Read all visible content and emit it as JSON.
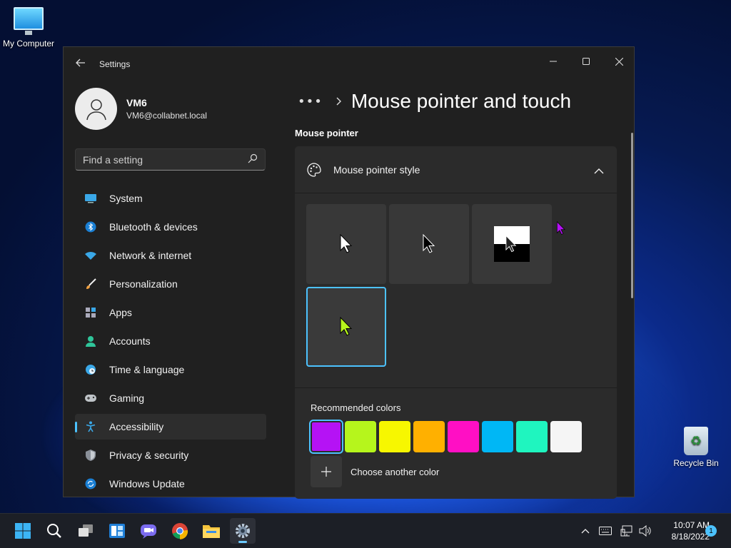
{
  "desktop": {
    "icons": [
      {
        "label": "My Computer",
        "icon": "computer-monitor-icon"
      },
      {
        "label": "Recycle Bin",
        "icon": "recycle-bin-icon"
      }
    ]
  },
  "window": {
    "app_title": "Settings",
    "controls": [
      "minimize",
      "maximize",
      "close"
    ]
  },
  "profile": {
    "name": "VM6",
    "email": "VM6@collabnet.local"
  },
  "search": {
    "placeholder": "Find a setting"
  },
  "nav": {
    "items": [
      {
        "label": "System",
        "icon": "system-icon"
      },
      {
        "label": "Bluetooth & devices",
        "icon": "bluetooth-icon"
      },
      {
        "label": "Network & internet",
        "icon": "wifi-icon"
      },
      {
        "label": "Personalization",
        "icon": "brush-icon"
      },
      {
        "label": "Apps",
        "icon": "apps-icon"
      },
      {
        "label": "Accounts",
        "icon": "accounts-icon"
      },
      {
        "label": "Time & language",
        "icon": "globe-clock-icon"
      },
      {
        "label": "Gaming",
        "icon": "gamepad-icon"
      },
      {
        "label": "Accessibility",
        "icon": "accessibility-icon",
        "active": true
      },
      {
        "label": "Privacy & security",
        "icon": "shield-icon"
      },
      {
        "label": "Windows Update",
        "icon": "update-icon"
      }
    ]
  },
  "page": {
    "breadcrumb_more": "•••",
    "title": "Mouse pointer and touch",
    "section_heading": "Mouse pointer"
  },
  "pointer_style": {
    "label": "Mouse pointer style",
    "expanded": true,
    "options": [
      "white",
      "black",
      "inverted",
      "custom"
    ],
    "selected": "custom"
  },
  "colors": {
    "heading": "Recommended colors",
    "swatches": [
      "#b512f5",
      "#b6f51c",
      "#f7f700",
      "#ffb000",
      "#ff0fc4",
      "#00b7f5",
      "#1ff5bf",
      "#f5f5f5"
    ],
    "selected_index": 0,
    "choose_label": "Choose another color"
  },
  "taskbar": {
    "apps": [
      "start-icon",
      "search-icon",
      "task-view-icon",
      "widgets-icon",
      "chat-icon",
      "chrome-icon",
      "file-explorer-icon",
      "settings-icon"
    ],
    "active_app": "settings-icon",
    "time": "10:07 AM",
    "date": "8/18/2022",
    "notification_count": "1"
  }
}
